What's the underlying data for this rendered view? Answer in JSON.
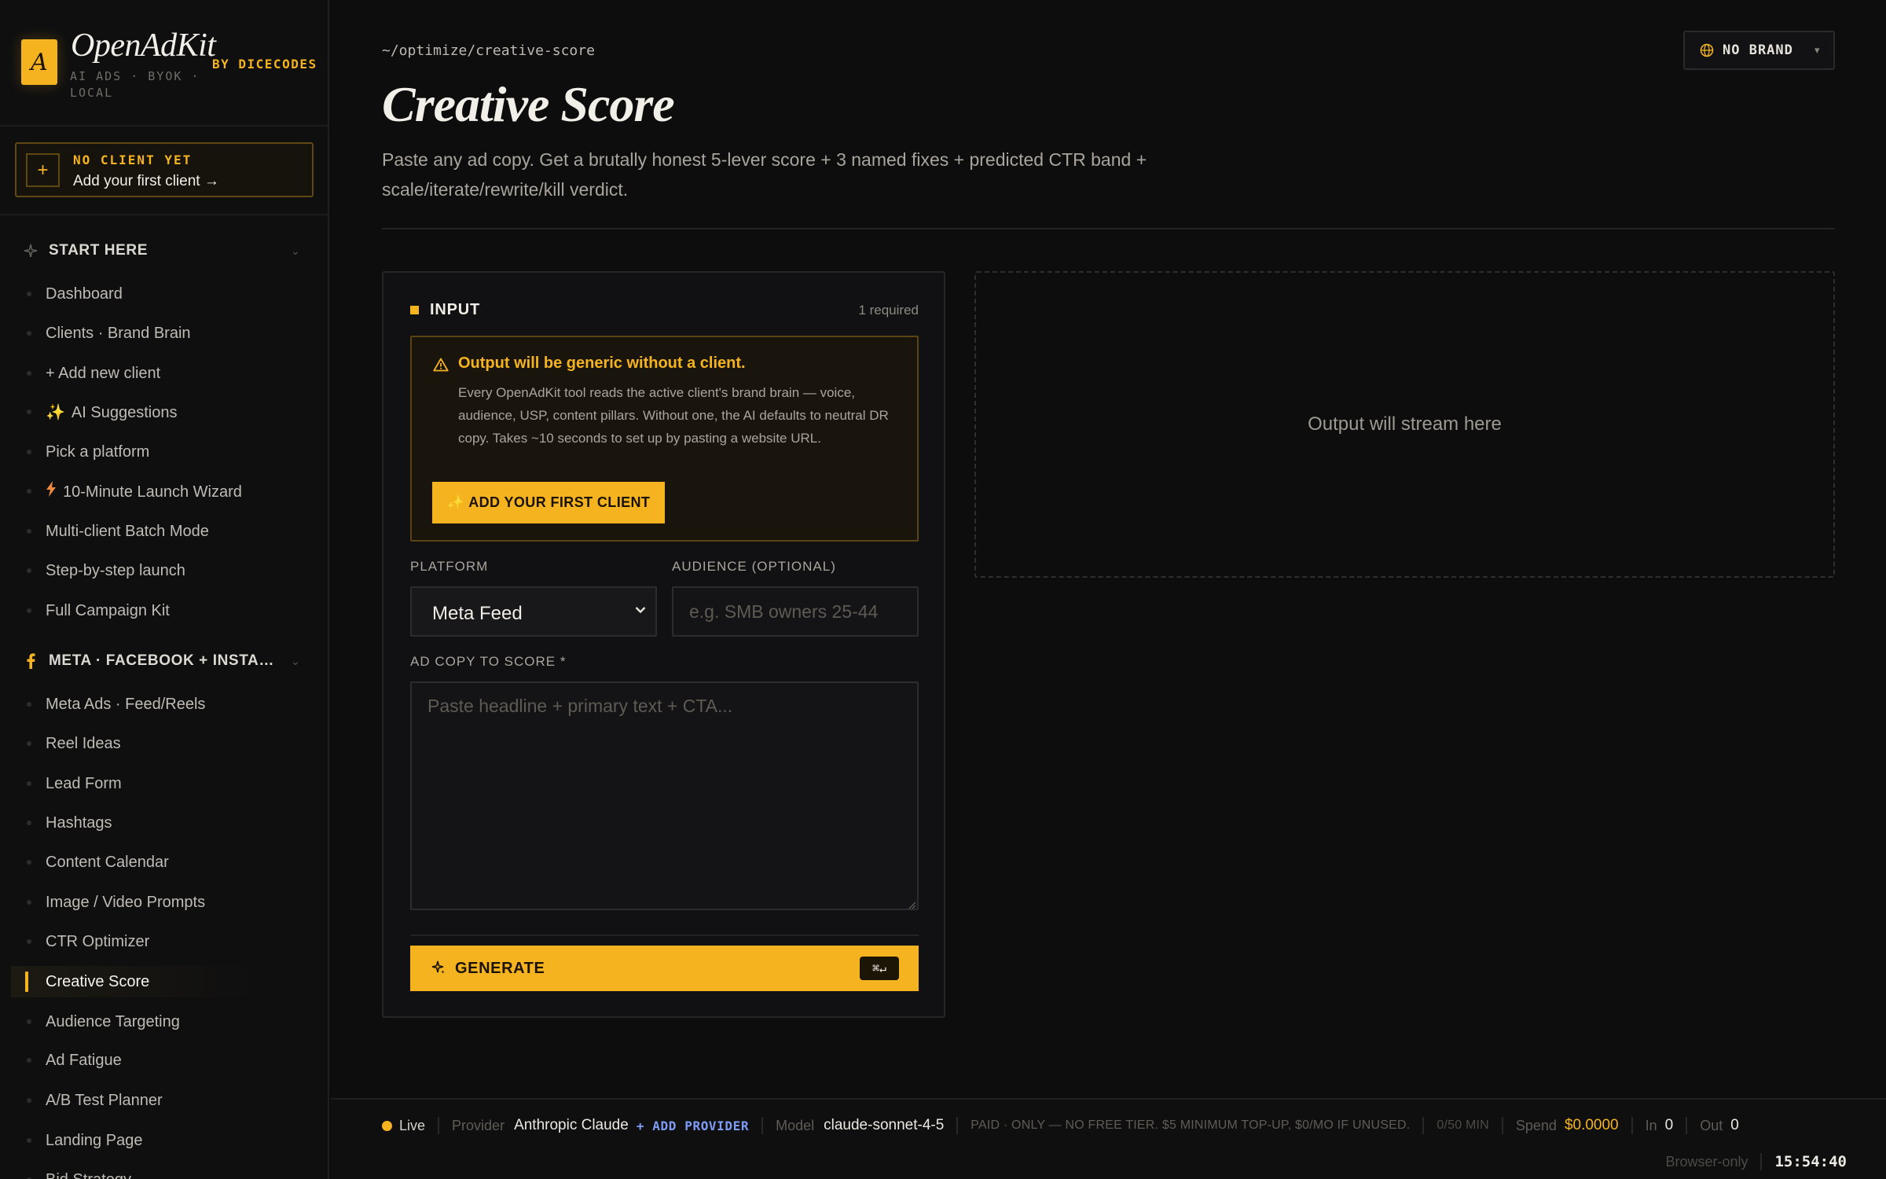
{
  "brand": {
    "logo_letter": "A",
    "name": "OpenAdKit",
    "tagline": "AI ADS · BYOK · LOCAL",
    "by": "BY DICECODES"
  },
  "client": {
    "status": "NO CLIENT YET",
    "cta": "Add your first client →",
    "plus": "+"
  },
  "sections": [
    {
      "label": "START HERE",
      "items": [
        "Dashboard",
        "Clients · Brand Brain",
        "+ Add new client",
        "AI Suggestions",
        "Pick a platform",
        "10-Minute Launch Wizard",
        "Multi-client Batch Mode",
        "Step-by-step launch",
        "Full Campaign Kit"
      ]
    },
    {
      "label": "META · FACEBOOK + INSTAGRAM",
      "items": [
        "Meta Ads · Feed/Reels",
        "Reel Ideas",
        "Lead Form",
        "Hashtags",
        "Content Calendar",
        "Image / Video Prompts",
        "CTR Optimizer",
        "Creative Score",
        "Audience Targeting",
        "Ad Fatigue",
        "A/B Test Planner",
        "Landing Page",
        "Bid Strategy"
      ]
    }
  ],
  "active_item": "Creative Score",
  "header": {
    "breadcrumb": "~/optimize/creative-score",
    "title": "Creative Score",
    "description": "Paste any ad copy. Get a brutally honest 5-lever score + 3 named fixes + predicted CTR band + scale/iterate/rewrite/kill verdict.",
    "brand_selector": "NO BRAND"
  },
  "input_panel": {
    "title": "INPUT",
    "required": "1 required",
    "warning": {
      "title": "Output will be generic without a client.",
      "body": "Every OpenAdKit tool reads the active client's brand brain — voice, audience, USP, content pillars. Without one, the AI defaults to neutral DR copy. Takes ~10 seconds to set up by pasting a website URL.",
      "button": "✨ ADD YOUR FIRST CLIENT"
    },
    "platform_label": "PLATFORM",
    "platform_value": "Meta Feed",
    "audience_label": "AUDIENCE (OPTIONAL)",
    "audience_placeholder": "e.g. SMB owners 25-44",
    "adcopy_label": "AD COPY TO SCORE *",
    "adcopy_placeholder": "Paste headline + primary text + CTA...",
    "generate": "GENERATE",
    "shortcut": "⌘↵"
  },
  "output": {
    "placeholder": "Output will stream here"
  },
  "status_bar": {
    "live": "Live",
    "provider_label": "Provider",
    "provider": "Anthropic Claude",
    "add_provider": "+ ADD PROVIDER",
    "model_label": "Model",
    "model": "claude-sonnet-4-5",
    "note": "PAID · ONLY — NO FREE TIER. $5 MINIMUM TOP-UP, $0/MO IF UNUSED.",
    "rate": "0/50 MIN",
    "spend_label": "Spend",
    "spend": "$0.0000",
    "in_label": "In",
    "in": "0",
    "out_label": "Out",
    "out": "0",
    "browser": "Browser-only",
    "clock": "15:54:40"
  },
  "colors": {
    "accent": "#f5b41f",
    "background": "#0d0d0e",
    "link": "#7f9cf5"
  }
}
